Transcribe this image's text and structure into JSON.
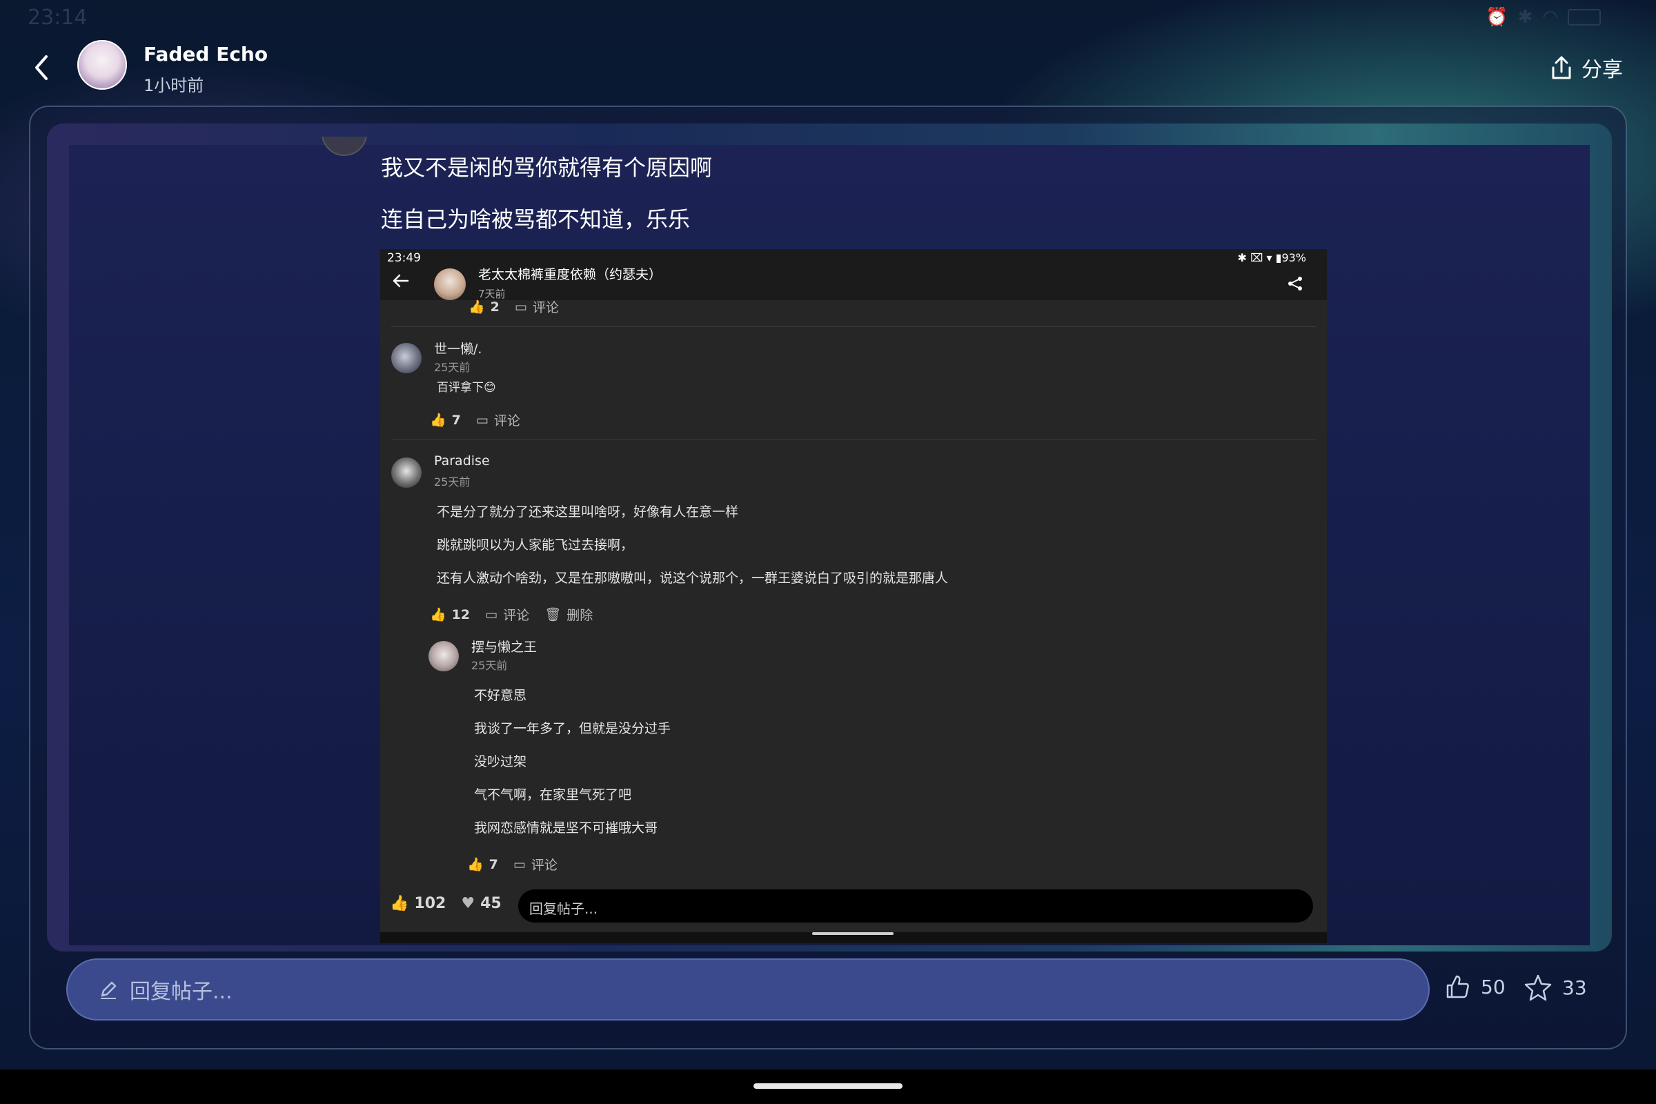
{
  "status_bar": {
    "time": "23:14"
  },
  "header": {
    "author": "Faded Echo",
    "time": "1小时前",
    "share_label": "分享"
  },
  "post": {
    "lines": [
      "我又不是闲的骂你就得有个原因啊",
      "连自己为啥被骂都不知道，乐乐"
    ]
  },
  "screenshot": {
    "status_time": "23:49",
    "status_battery": "93%",
    "title": "老太太棉裤重度依赖（约瑟夫）",
    "subtime": "7天前",
    "top_like": "2",
    "comment_label": "评论",
    "delete_label": "删除",
    "comments": [
      {
        "name": "世一懒/.",
        "time": "25天前",
        "lines": [
          "百评拿下😊"
        ],
        "likes": "7"
      },
      {
        "name": "Paradise",
        "time": "25天前",
        "lines": [
          "不是分了就分了还来这里叫啥呀，好像有人在意一样",
          "跳就跳呗以为人家能飞过去接啊，",
          "还有人激动个啥劲，又是在那嗷嗷叫，说这个说那个，一群王婆说白了吸引的就是那唐人"
        ],
        "likes": "12"
      }
    ],
    "reply": {
      "name": "摆与懒之王",
      "time": "25天前",
      "lines": [
        "不好意思",
        "我谈了一年多了，但就是没分过手",
        "没吵过架",
        "气不气啊，在家里气死了吧",
        "我网恋感情就是坚不可摧哦大哥"
      ],
      "likes": "7"
    },
    "bottom_likes": "102",
    "bottom_hearts": "45",
    "reply_placeholder": "回复帖子..."
  },
  "bottom_bar": {
    "reply_placeholder": "回复帖子...",
    "likes": "50",
    "stars": "33"
  }
}
